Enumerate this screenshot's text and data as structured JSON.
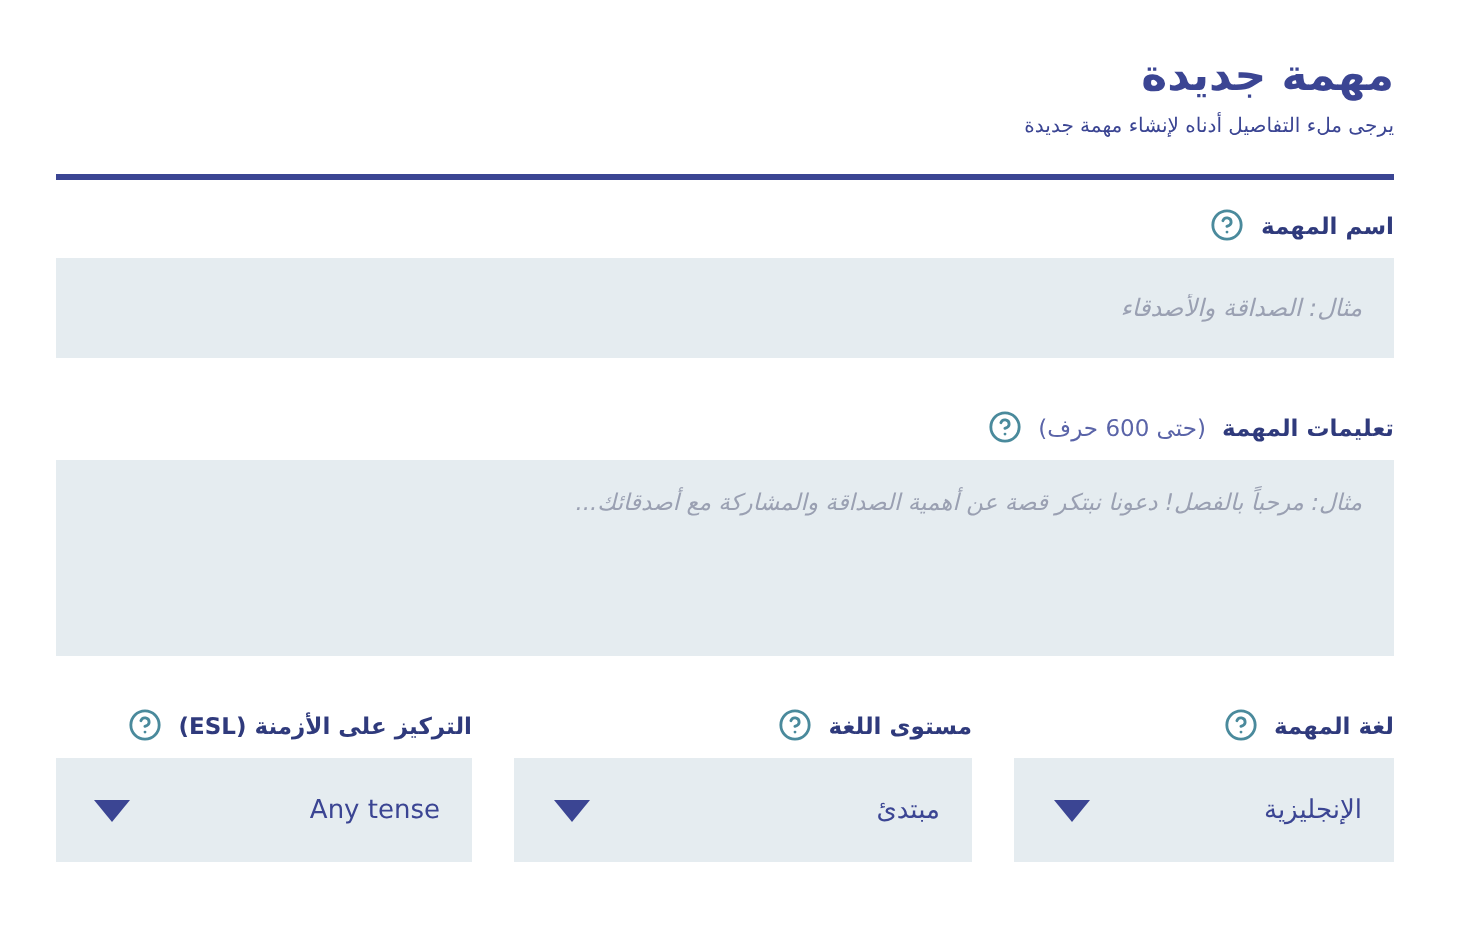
{
  "header": {
    "title": "مهمة جديدة",
    "subtitle": "يرجى ملء التفاصيل أدناه لإنشاء مهمة جديدة"
  },
  "task_name": {
    "label": "اسم المهمة",
    "placeholder": "مثال: الصداقة والأصدقاء"
  },
  "instructions": {
    "label": "تعليمات المهمة",
    "limit_note": "(حتى 600 حرف)",
    "placeholder": "مثال: مرحباً بالفصل! دعونا نبتكر قصة عن أهمية الصداقة والمشاركة مع أصدقائك..."
  },
  "selects": [
    {
      "label": "لغة المهمة",
      "value": "الإنجليزية"
    },
    {
      "label": "مستوى اللغة",
      "value": "مبتدئ"
    },
    {
      "label": "التركيز على الأزمنة (ESL)",
      "value": "Any tense"
    }
  ]
}
